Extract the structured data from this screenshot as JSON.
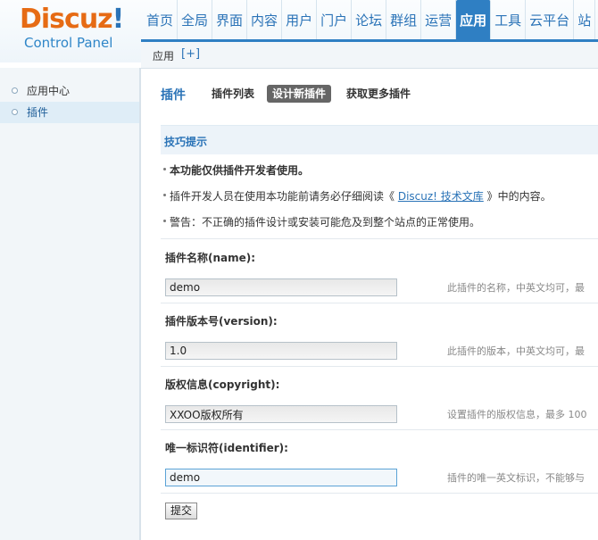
{
  "logo": {
    "brand": "Discuz",
    "bang": "!",
    "subtitle": "Control Panel"
  },
  "topnav": {
    "tabs": [
      {
        "label": "首页",
        "active": false
      },
      {
        "label": "全局",
        "active": false
      },
      {
        "label": "界面",
        "active": false
      },
      {
        "label": "内容",
        "active": false
      },
      {
        "label": "用户",
        "active": false
      },
      {
        "label": "门户",
        "active": false
      },
      {
        "label": "论坛",
        "active": false
      },
      {
        "label": "群组",
        "active": false
      },
      {
        "label": "运营",
        "active": false
      },
      {
        "label": "应用",
        "active": true
      },
      {
        "label": "工具",
        "active": false
      },
      {
        "label": "云平台",
        "active": false
      },
      {
        "label": "站",
        "active": false
      }
    ]
  },
  "subnav": {
    "crumb": "应用",
    "add": "[+]"
  },
  "sidebar": {
    "items": [
      {
        "label": "应用中心",
        "active": false
      },
      {
        "label": "插件",
        "active": true
      }
    ]
  },
  "main": {
    "title": "插件",
    "tabs": [
      {
        "label": "插件列表",
        "active": false
      },
      {
        "label": "设计新插件",
        "active": true
      },
      {
        "label": "获取更多插件",
        "active": false
      }
    ],
    "tips": {
      "header": "技巧提示",
      "line1": "本功能仅供插件开发者使用。",
      "line2_pre": "插件开发人员在使用本功能前请务必仔细阅读《 ",
      "line2_link": "Discuz! 技术文库",
      "line2_post": " 》中的内容。",
      "line3": "警告：不正确的插件设计或安装可能危及到整个站点的正常使用。"
    },
    "fields": [
      {
        "label": "插件名称(name):",
        "value": "demo",
        "hint": "此插件的名称，中英文均可，最"
      },
      {
        "label": "插件版本号(version):",
        "value": "1.0",
        "hint": "此插件的版本，中英文均可，最"
      },
      {
        "label": "版权信息(copyright):",
        "value": "XXOO版权所有",
        "hint": "设置插件的版权信息，最多 100"
      },
      {
        "label": "唯一标识符(identifier):",
        "value": "demo",
        "hint": "插件的唯一英文标识，不能够与"
      }
    ],
    "submit": "提交"
  },
  "colors": {
    "accent": "#2f7fc3",
    "brand_orange": "#e66b14",
    "link": "#2a73b7"
  }
}
